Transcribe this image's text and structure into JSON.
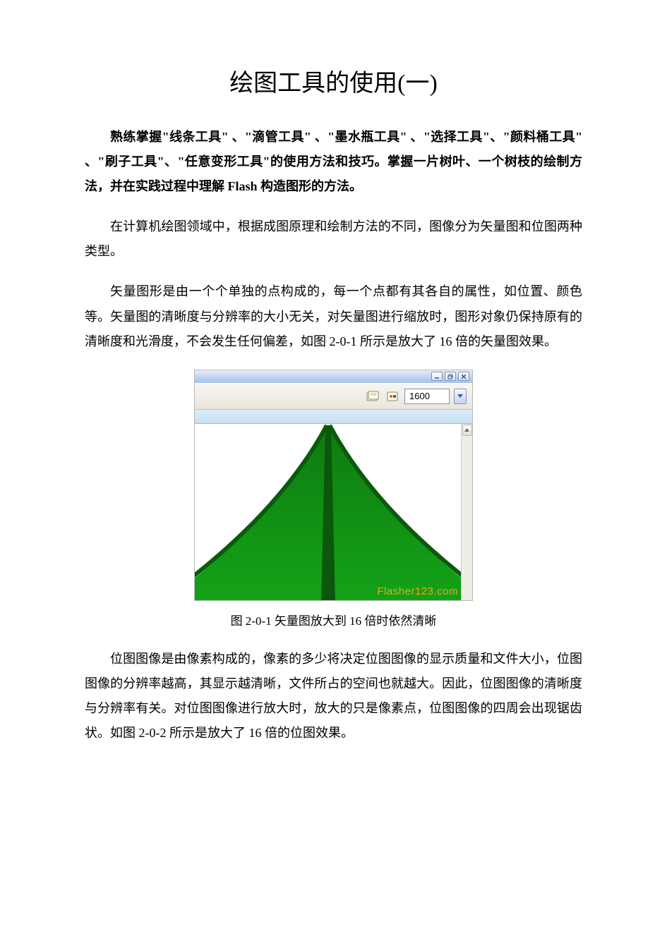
{
  "title": "绘图工具的使用(一)",
  "intro_bold": "熟练掌握\"线条工具\" 、\"滴管工具\" 、\"墨水瓶工具\" 、\"选择工具\"、\"颜料桶工具\" 、\"刷子工具\"、\"任意变形工具\"的使用方法和技巧。掌握一片树叶、一个树枝的绘制方法，并在实践过程中理解 Flash 构造图形的方法。",
  "p1": "在计算机绘图领域中，根据成图原理和绘制方法的不同，图像分为矢量图和位图两种类型。",
  "p2": "矢量图形是由一个个单独的点构成的，每一个点都有其各自的属性，如位置、颜色等。矢量图的清晰度与分辨率的大小无关，对矢量图进行缩放时，图形对象仍保持原有的清晰度和光滑度，不会发生任何偏差，如图 2-0-1 所示是放大了 16 倍的矢量图效果。",
  "figure": {
    "zoom_value": "1600",
    "watermark": "Flasher123.com"
  },
  "caption1": "图 2-0-1 矢量图放大到 16 倍时依然清晰",
  "p3": "位图图像是由像素构成的，像素的多少将决定位图图像的显示质量和文件大小，位图图像的分辨率越高，其显示越清晰，文件所占的空间也就越大。因此，位图图像的清晰度与分辨率有关。对位图图像进行放大时，放大的只是像素点，位图图像的四周会出现锯齿状。如图 2-0-2 所示是放大了 16 倍的位图效果。"
}
